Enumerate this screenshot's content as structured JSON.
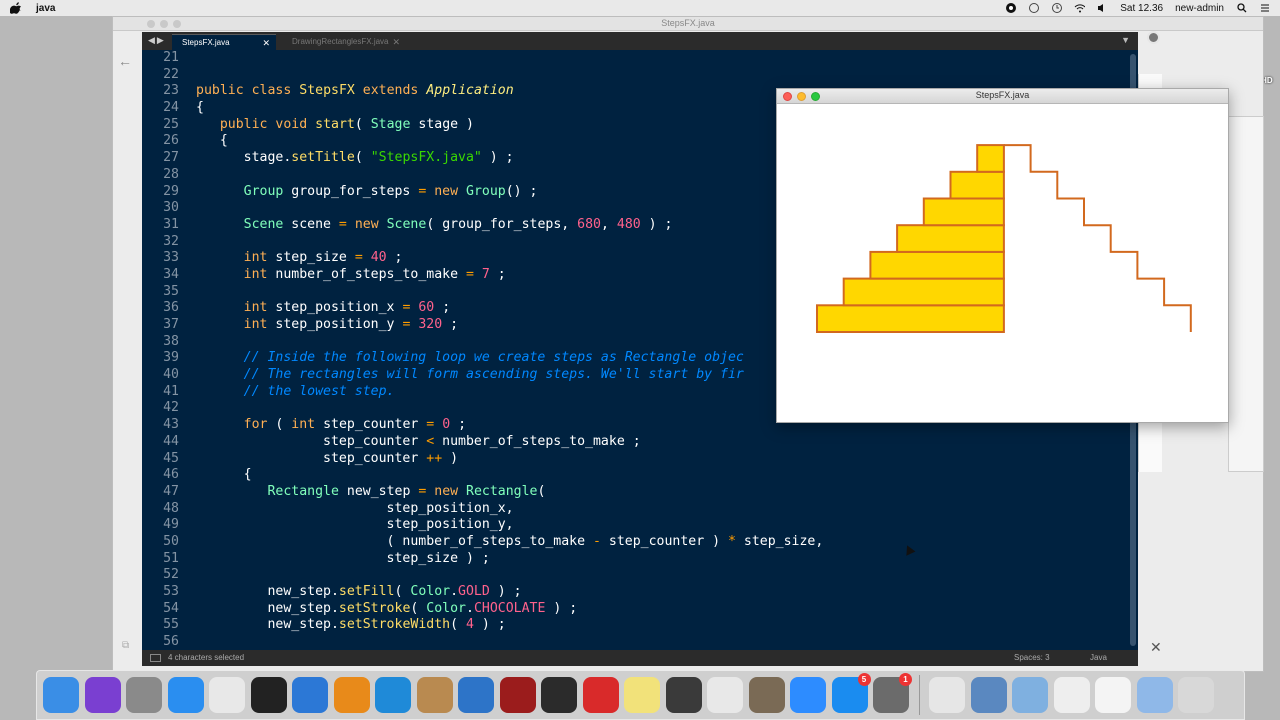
{
  "menubar": {
    "app_name": "java",
    "clock": "Sat 12.36",
    "user": "new-admin"
  },
  "desktop": {
    "disk_label": "Macintosh HD"
  },
  "background_window": {
    "title": "StepsFX.java"
  },
  "editor": {
    "tabs": [
      {
        "label": "StepsFX.java",
        "active": true
      },
      {
        "label": "DrawingRectanglesFX.java",
        "active": false
      }
    ],
    "status": {
      "selection": "4 characters selected",
      "spaces": "Spaces: 3",
      "language": "Java"
    },
    "lines": [
      {
        "n": "21",
        "code": ""
      },
      {
        "n": "22",
        "code": ""
      },
      {
        "n": "23",
        "code": "public class StepsFX extends Application"
      },
      {
        "n": "24",
        "code": "{"
      },
      {
        "n": "25",
        "code": "   public void start( Stage stage )"
      },
      {
        "n": "26",
        "code": "   {"
      },
      {
        "n": "27",
        "code": "      stage.setTitle( \"StepsFX.java\" ) ;"
      },
      {
        "n": "28",
        "code": ""
      },
      {
        "n": "29",
        "code": "      Group group_for_steps = new Group() ;"
      },
      {
        "n": "30",
        "code": ""
      },
      {
        "n": "31",
        "code": "      Scene scene = new Scene( group_for_steps, 680, 480 ) ;"
      },
      {
        "n": "32",
        "code": ""
      },
      {
        "n": "33",
        "code": "      int step_size = 40 ;"
      },
      {
        "n": "34",
        "code": "      int number_of_steps_to_make = 7 ;"
      },
      {
        "n": "35",
        "code": ""
      },
      {
        "n": "36",
        "code": "      int step_position_x = 60 ;"
      },
      {
        "n": "37",
        "code": "      int step_position_y = 320 ;"
      },
      {
        "n": "38",
        "code": ""
      },
      {
        "n": "39",
        "code": "      // Inside the following loop we create steps as Rectangle objec"
      },
      {
        "n": "40",
        "code": "      // The rectangles will form ascending steps. We'll start by fir"
      },
      {
        "n": "41",
        "code": "      // the lowest step."
      },
      {
        "n": "42",
        "code": ""
      },
      {
        "n": "43",
        "code": "      for ( int step_counter = 0 ;"
      },
      {
        "n": "44",
        "code": "                step_counter < number_of_steps_to_make ;"
      },
      {
        "n": "45",
        "code": "                step_counter ++ )"
      },
      {
        "n": "46",
        "code": "      {"
      },
      {
        "n": "47",
        "code": "         Rectangle new_step = new Rectangle("
      },
      {
        "n": "48",
        "code": "                        step_position_x,"
      },
      {
        "n": "49",
        "code": "                        step_position_y,"
      },
      {
        "n": "50",
        "code": "                        ( number_of_steps_to_make - step_counter ) * step_size,"
      },
      {
        "n": "51",
        "code": "                        step_size ) ;"
      },
      {
        "n": "52",
        "code": ""
      },
      {
        "n": "53",
        "code": "         new_step.setFill( Color.GOLD ) ;"
      },
      {
        "n": "54",
        "code": "         new_step.setStroke( Color.CHOCOLATE ) ;"
      },
      {
        "n": "55",
        "code": "         new_step.setStrokeWidth( 4 ) ;"
      },
      {
        "n": "56",
        "code": ""
      }
    ]
  },
  "fx_window": {
    "title": "StepsFX.java",
    "steps_count": 7,
    "fill_color": "#FFD700",
    "stroke_color": "#D2691E"
  },
  "dock": {
    "items": [
      {
        "name": "finder-icon",
        "color": "#3a8ee6"
      },
      {
        "name": "siri-icon",
        "color": "#7a3fd1"
      },
      {
        "name": "launchpad-icon",
        "color": "#8a8a8a"
      },
      {
        "name": "safari-icon",
        "color": "#2a8ef0"
      },
      {
        "name": "chrome-icon",
        "color": "#e8e8e8"
      },
      {
        "name": "terminal-icon",
        "color": "#222222"
      },
      {
        "name": "xcode-icon",
        "color": "#2c78d6"
      },
      {
        "name": "sublime-icon",
        "color": "#e88a1a"
      },
      {
        "name": "vscode-icon",
        "color": "#1f8ad8"
      },
      {
        "name": "contacts-icon",
        "color": "#b98a50"
      },
      {
        "name": "preview-icon",
        "color": "#2d74c8"
      },
      {
        "name": "photo-booth-icon",
        "color": "#9b1c1c"
      },
      {
        "name": "activity-monitor-icon",
        "color": "#2b2b2b"
      },
      {
        "name": "sketch-icon",
        "color": "#d92a2a"
      },
      {
        "name": "notes-icon",
        "color": "#f2e27a"
      },
      {
        "name": "quicktime-icon",
        "color": "#3a3a3a"
      },
      {
        "name": "itunes-icon",
        "color": "#e8e8e8"
      },
      {
        "name": "gimp-icon",
        "color": "#7a6a55"
      },
      {
        "name": "zoom-icon",
        "color": "#2d8cff"
      },
      {
        "name": "app-store-icon",
        "color": "#1a8cf0",
        "badge": "5"
      },
      {
        "name": "system-preferences-icon",
        "color": "#6b6b6b",
        "badge": "1"
      },
      {
        "name": "numbers-icon",
        "color": "#e6e6e6"
      },
      {
        "name": "image-viewer-icon",
        "color": "#5a88c0"
      },
      {
        "name": "virtualbox-icon",
        "color": "#7fb0e0"
      },
      {
        "name": "java-icon",
        "color": "#eeeeee"
      },
      {
        "name": "document-icon",
        "color": "#f4f4f4"
      },
      {
        "name": "cube-icon",
        "color": "#8fb8e8"
      },
      {
        "name": "trash-icon",
        "color": "#d8d8d8"
      }
    ]
  }
}
